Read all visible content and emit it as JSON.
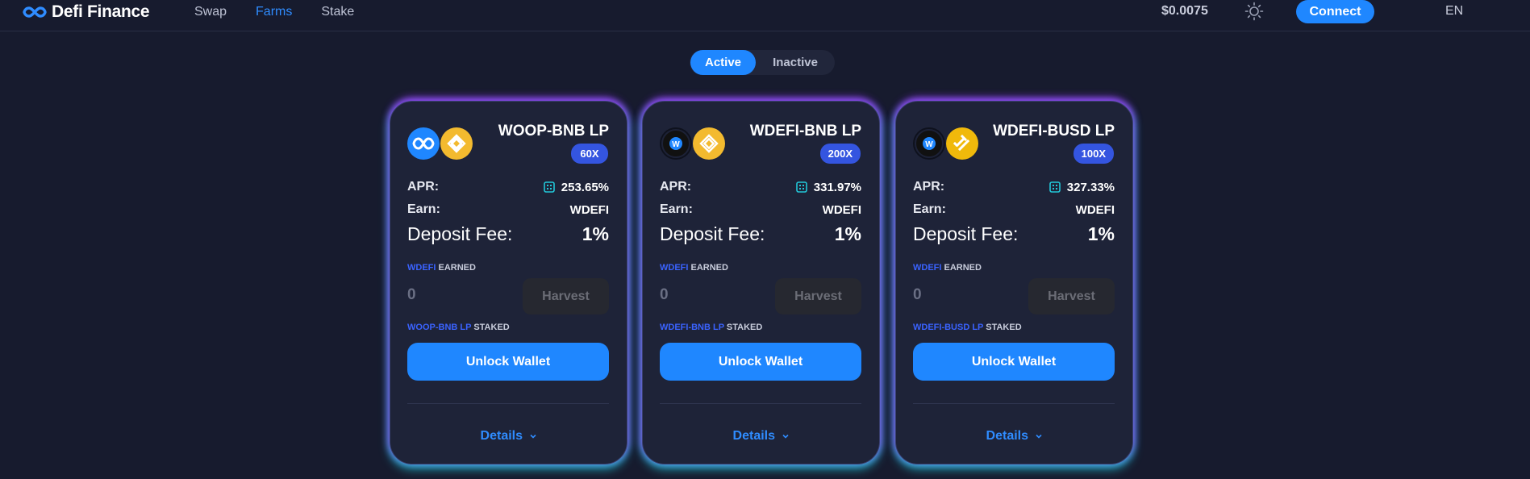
{
  "header": {
    "logo_text": "Defi Finance",
    "nav": [
      {
        "label": "Swap"
      },
      {
        "label": "Farms",
        "active": true
      },
      {
        "label": "Stake"
      }
    ],
    "price": "$0.0075",
    "theme_icon": "sun-icon",
    "connect_label": "Connect",
    "language": "EN"
  },
  "toggle": {
    "active_label": "Active",
    "inactive_label": "Inactive"
  },
  "colors": {
    "background": "#171b2e",
    "card": "#1e2338",
    "accent": "#1f87ff",
    "multiplier_badge": "#3455e0",
    "token_label": "#3a63ff"
  },
  "farms": [
    {
      "name": "WOOP-BNB LP",
      "multiplier": "60X",
      "icons": [
        "woop-infinity-icon",
        "bnb-icon"
      ],
      "apr_label": "APR:",
      "apr": "253.65%",
      "earn_label": "Earn:",
      "earn": "WDEFI",
      "fee_label": "Deposit Fee:",
      "fee": "1%",
      "earned_token": "WDEFI",
      "earned_suffix": "EARNED",
      "earned_value": "0",
      "harvest_label": "Harvest",
      "staked_token": "WOOP-BNB LP",
      "staked_suffix": "STAKED",
      "unlock_label": "Unlock Wallet",
      "details_label": "Details"
    },
    {
      "name": "WDEFI-BNB LP",
      "multiplier": "200X",
      "icons": [
        "wdefi-icon",
        "bnb-icon"
      ],
      "apr_label": "APR:",
      "apr": "331.97%",
      "earn_label": "Earn:",
      "earn": "WDEFI",
      "fee_label": "Deposit Fee:",
      "fee": "1%",
      "earned_token": "WDEFI",
      "earned_suffix": "EARNED",
      "earned_value": "0",
      "harvest_label": "Harvest",
      "staked_token": "WDEFI-BNB LP",
      "staked_suffix": "STAKED",
      "unlock_label": "Unlock Wallet",
      "details_label": "Details"
    },
    {
      "name": "WDEFI-BUSD LP",
      "multiplier": "100X",
      "icons": [
        "wdefi-icon",
        "busd-icon"
      ],
      "apr_label": "APR:",
      "apr": "327.33%",
      "earn_label": "Earn:",
      "earn": "WDEFI",
      "fee_label": "Deposit Fee:",
      "fee": "1%",
      "earned_token": "WDEFI",
      "earned_suffix": "EARNED",
      "earned_value": "0",
      "harvest_label": "Harvest",
      "staked_token": "WDEFI-BUSD LP",
      "staked_suffix": "STAKED",
      "unlock_label": "Unlock Wallet",
      "details_label": "Details"
    }
  ]
}
